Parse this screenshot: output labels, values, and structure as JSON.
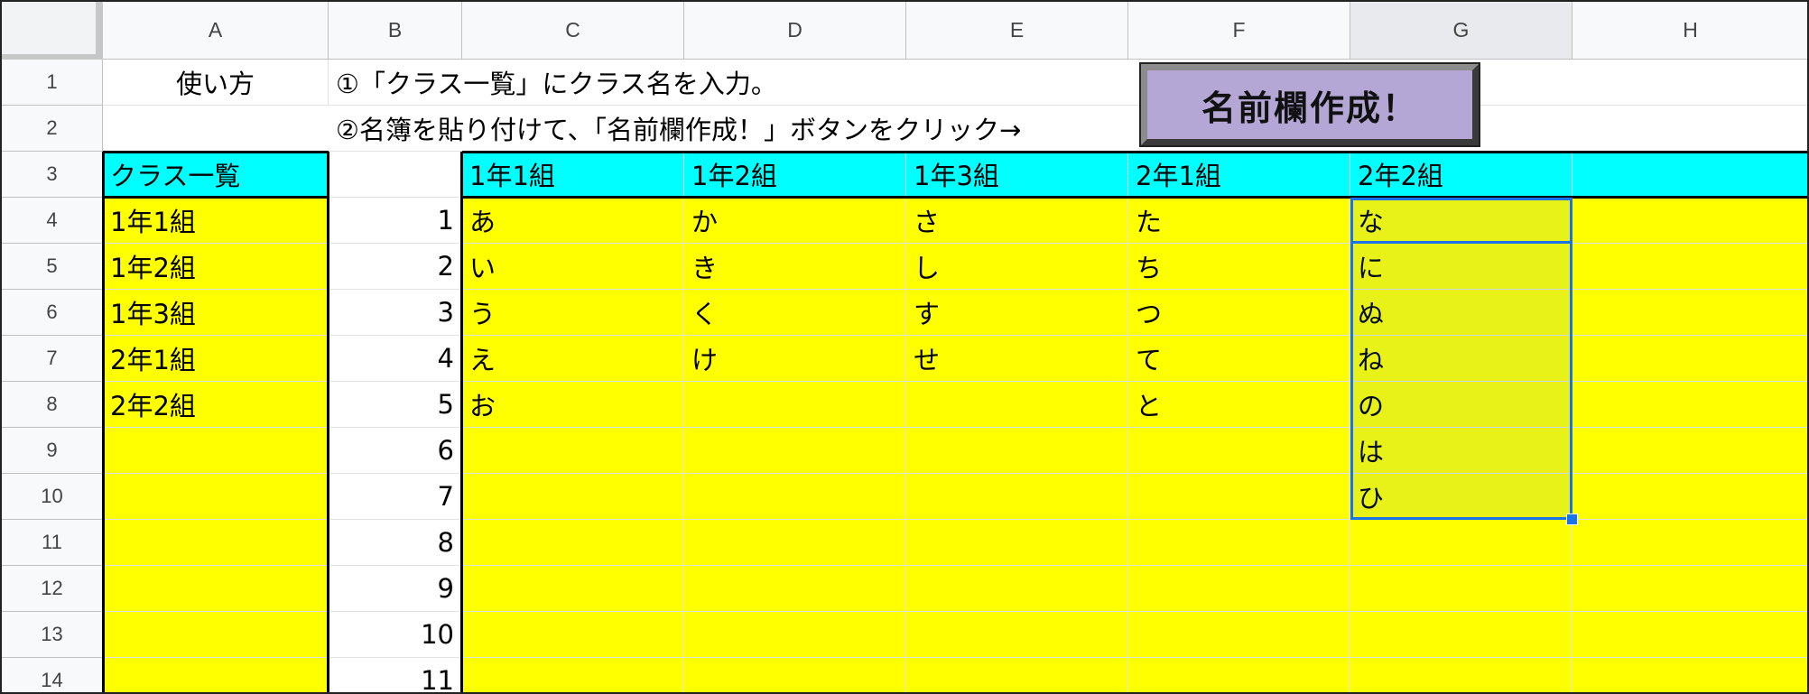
{
  "columns": [
    "A",
    "B",
    "C",
    "D",
    "E",
    "F",
    "G",
    "H"
  ],
  "rows": [
    "1",
    "2",
    "3",
    "4",
    "5",
    "6",
    "7",
    "8",
    "9",
    "10",
    "11",
    "12",
    "13",
    "14"
  ],
  "instructions": {
    "a1": "使い方",
    "step1": "①「クラス一覧」にクラス名を入力。",
    "step2": "②名簿を貼り付けて、「名前欄作成！」ボタンをクリック→"
  },
  "button": {
    "label": "名前欄作成！"
  },
  "class_list": {
    "header": "クラス一覧",
    "items": [
      "1年1組",
      "1年2組",
      "1年3組",
      "2年1組",
      "2年2組"
    ]
  },
  "numbers": [
    "1",
    "2",
    "3",
    "4",
    "5",
    "6",
    "7",
    "8",
    "9",
    "10",
    "11"
  ],
  "class_headers": [
    "1年1組",
    "1年2組",
    "1年3組",
    "2年1組",
    "2年2組"
  ],
  "rosters": [
    [
      "あ",
      "い",
      "う",
      "え",
      "お"
    ],
    [
      "か",
      "き",
      "く",
      "け"
    ],
    [
      "さ",
      "し",
      "す",
      "せ"
    ],
    [
      "た",
      "ち",
      "つ",
      "て",
      "と"
    ],
    [
      "な",
      "に",
      "ぬ",
      "ね",
      "の",
      "は",
      "ひ"
    ]
  ],
  "colors": {
    "header_fill": "#00ffff",
    "body_fill": "#ffff00",
    "selection": "#1a73e8",
    "button_fill": "#b4a7d6"
  }
}
